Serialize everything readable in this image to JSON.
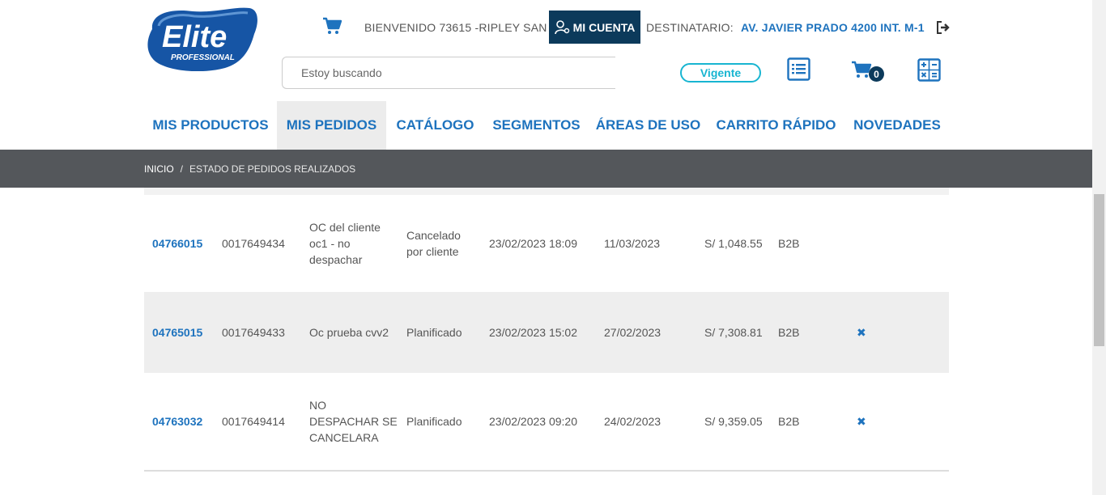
{
  "header": {
    "logo_text": "Elite",
    "logo_subtext": "PROFESSIONAL",
    "welcome": "BIENVENIDO 73615 -RIPLEY SAN",
    "account_label": "MI CUENTA",
    "destination_label": "DESTINATARIO:",
    "destination_value": "AV. JAVIER PRADO 4200 INT. M-1",
    "search_placeholder": "Estoy buscando",
    "status_badge": "Vigente",
    "cart_count": "0",
    "icons": [
      "cart-icon",
      "user-key-icon",
      "logout-icon",
      "list-icon",
      "cart-icon",
      "calculator-icon"
    ]
  },
  "nav": {
    "items": [
      {
        "label": "MIS PRODUCTOS"
      },
      {
        "label": "MIS PEDIDOS"
      },
      {
        "label": "CATÁLOGO"
      },
      {
        "label": "SEGMENTOS"
      },
      {
        "label": "ÁREAS DE USO"
      },
      {
        "label": "CARRITO RÁPIDO"
      },
      {
        "label": "NOVEDADES"
      }
    ],
    "active": "MIS PEDIDOS"
  },
  "breadcrumb": {
    "home": "INICIO",
    "separator": "/",
    "current": "ESTADO DE PEDIDOS REALIZADOS"
  },
  "orders": {
    "rows": [
      {
        "id": "04766015",
        "ref": "0017649434",
        "oc": "OC del cliente oc1 - no despachar",
        "state": "Cancelado por cliente",
        "date": "23/02/2023 18:09",
        "delivery": "11/03/2023",
        "total": "S/ 1,048.55",
        "channel": "B2B",
        "delete": ""
      },
      {
        "id": "04765015",
        "ref": "0017649433",
        "oc": "Oc prueba cvv2",
        "state": "Planificado",
        "date": "23/02/2023 15:02",
        "delivery": "27/02/2023",
        "total": "S/ 7,308.81",
        "channel": "B2B",
        "delete": "✖"
      },
      {
        "id": "04763032",
        "ref": "0017649414",
        "oc": "NO DESPACHAR SE CANCELARA",
        "state": "Planificado",
        "date": "23/02/2023 09:20",
        "delivery": "24/02/2023",
        "total": "S/ 9,359.05",
        "channel": "B2B",
        "delete": "✖"
      }
    ]
  },
  "colors": {
    "brand_blue": "#1e73be",
    "dark_navy": "#0c3a5b",
    "accent_cyan": "#18b5d1",
    "breadcrumb_bg": "#54575b",
    "logo_blue": "#1655a5"
  }
}
